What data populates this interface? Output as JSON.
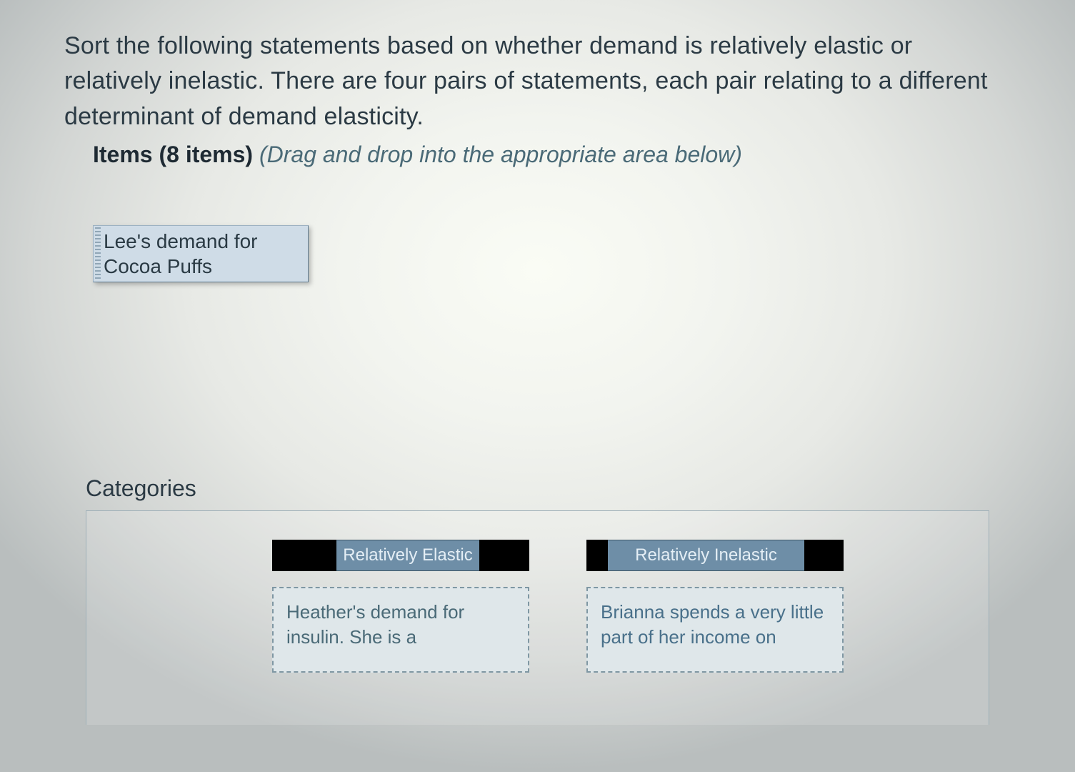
{
  "question": {
    "text": "Sort the following statements based on whether demand is relatively elastic or relatively inelastic. There are four pairs of statements, each pair relating to a different determinant of demand elasticity."
  },
  "items_heading": {
    "bold": "Items (8 items)",
    "hint": "(Drag and drop into the appropriate area below)"
  },
  "unsorted_items": [
    {
      "text": "Lee's demand for Cocoa Puffs"
    }
  ],
  "categories_heading": "Categories",
  "categories": [
    {
      "label": "Relatively Elastic",
      "dropped": "Heather's demand for insulin. She is a"
    },
    {
      "label": "Relatively Inelastic",
      "dropped": "Brianna spends a very little part of her income on"
    }
  ]
}
